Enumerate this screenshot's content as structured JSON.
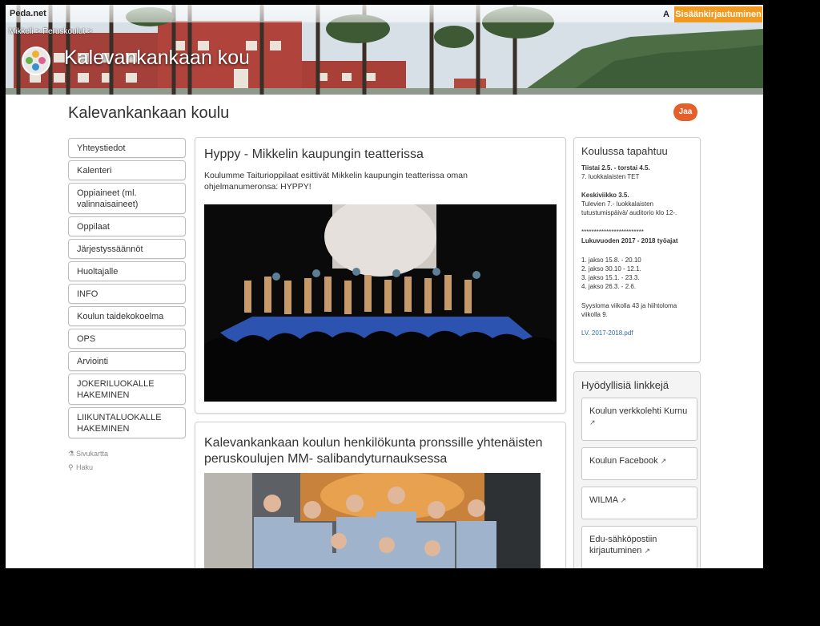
{
  "header": {
    "brand": "Peda.net",
    "font_size_label": "A",
    "login_label": "Sisäänkirjautuminen",
    "breadcrumbs": [
      "Mikkeli",
      ">",
      "Peruskoulut",
      ">"
    ],
    "banner_title": "Kalevankankaan koulu"
  },
  "page_title": "Kalevankankaan koulu",
  "share_label": "Jaa",
  "nav": {
    "items": [
      {
        "label": "Yhteystiedot"
      },
      {
        "label": "Kalenteri"
      },
      {
        "label": "Oppiaineet (ml. valinnaisaineet)"
      },
      {
        "label": "Oppilaat"
      },
      {
        "label": "Järjestyssäännöt"
      },
      {
        "label": "Huoltajalle"
      },
      {
        "label": "INFO"
      },
      {
        "label": "Koulun taidekokoelma"
      },
      {
        "label": "OPS"
      },
      {
        "label": "Arviointi"
      },
      {
        "label": "JOKERILUOKALLE HAKEMINEN"
      },
      {
        "label": "LIIKUNTALUOKALLE HAKEMINEN"
      }
    ],
    "sitemap_label": "Sivukartta",
    "search_label": "Haku"
  },
  "posts": [
    {
      "title": "Hyppy - Mikkelin kaupungin teatterissa",
      "text": "Koulumme Taituri­oppilaat esittivät Mikkelin kaupungin teatterissa oman ohjelmanumeronsa: HYPPY!"
    },
    {
      "title": "Kalevankankaan koulun henkilökunta pronssille yhtenäisten peruskoulujen MM- salibandyturnauksessa"
    }
  ],
  "events": {
    "title": "Koulussa tapahtuu",
    "e1_date": "Tiistai 2.5. - torstai 4.5.",
    "e1_text": "7. luokkalaisten TET",
    "e2_date": "Keskiviikko 3.5.",
    "e2_text": "Tulevien 7.- luokkalaisten tutustumispäivä/ auditorio klo 12-.",
    "stars": "*************************",
    "year_title": "Lukuvuoden 2017 - 2018 työajat",
    "periods": [
      "1. jakso 15.8. - 20.10",
      "2. jakso 30.10 - 12.1.",
      "3. jakso 15.1. - 23.3.",
      "4. jakso 26.3. - 2.6."
    ],
    "holidays": "Syysloma viikolla 43 ja hiihtoloma viikolla 9.",
    "file_link": "LV. 2017-2018.pdf"
  },
  "links": {
    "title": "Hyödyllisiä linkkejä",
    "items": [
      {
        "label": "Koulun verkkolehti Kurnu"
      },
      {
        "label": "Koulun Facebook"
      },
      {
        "label": "WILMA"
      },
      {
        "label": "Edu-sähköpostiin kirjautuminen"
      }
    ],
    "external_icon": "external-link-icon"
  },
  "colors": {
    "login_orange": "#f19a1f",
    "share_orange": "#e4602a",
    "link_blue": "#2a6cb0"
  }
}
